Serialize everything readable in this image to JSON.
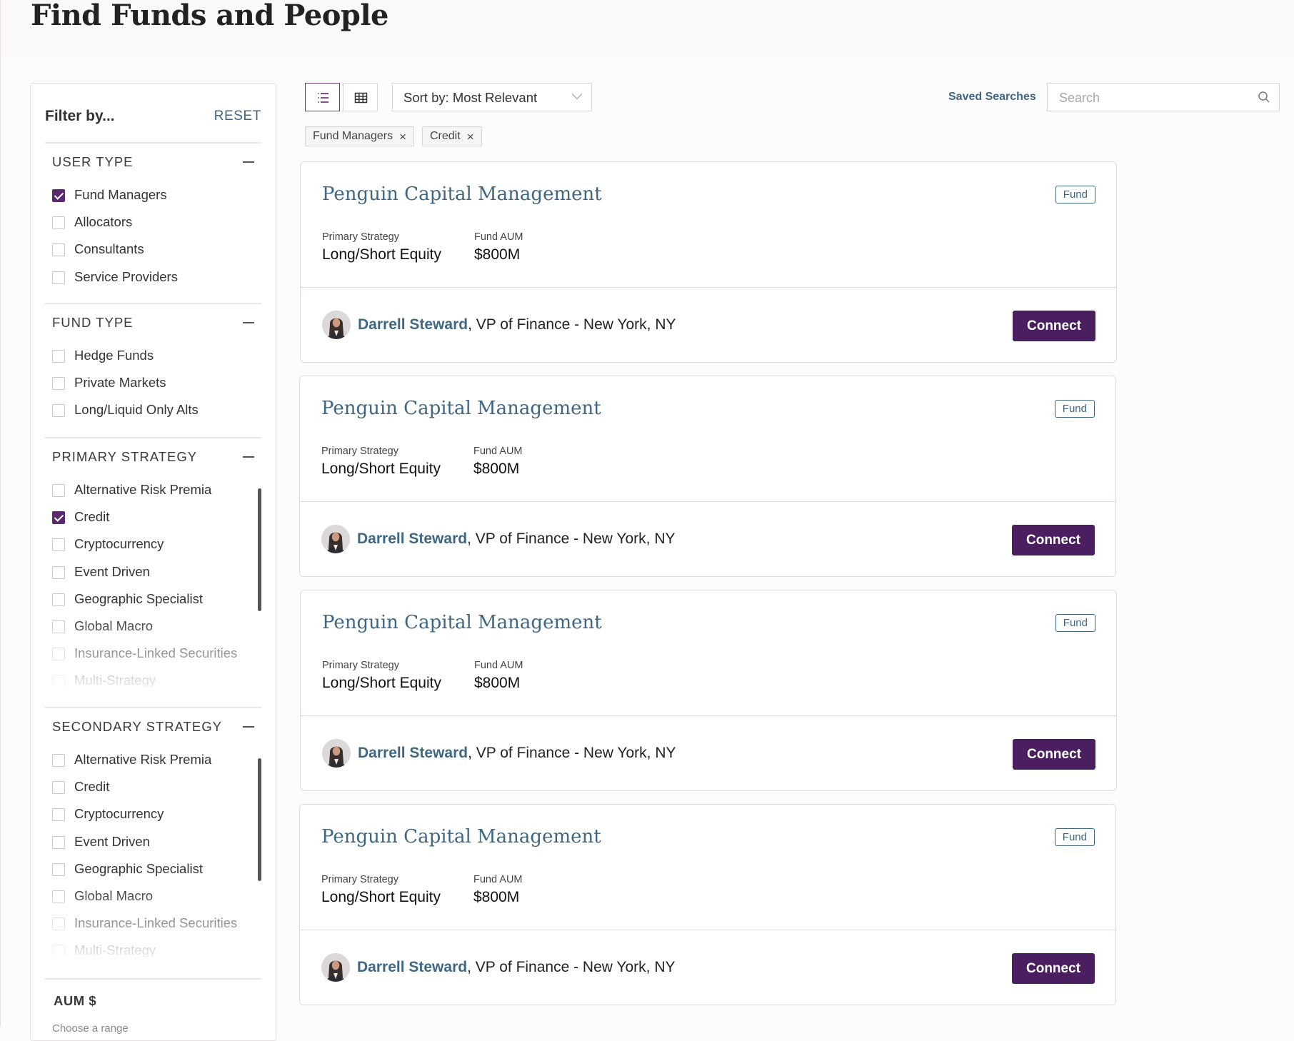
{
  "page": {
    "title": "Find Funds and People"
  },
  "sidebar": {
    "title": "Filter by...",
    "reset": "RESET",
    "sections": [
      {
        "title": "USER TYPE",
        "options": [
          {
            "label": "Fund Managers",
            "checked": true
          },
          {
            "label": "Allocators",
            "checked": false
          },
          {
            "label": "Consultants",
            "checked": false
          },
          {
            "label": "Service Providers",
            "checked": false
          }
        ]
      },
      {
        "title": "FUND TYPE",
        "options": [
          {
            "label": "Hedge Funds",
            "checked": false
          },
          {
            "label": "Private Markets",
            "checked": false
          },
          {
            "label": "Long/Liquid Only Alts",
            "checked": false
          }
        ]
      },
      {
        "title": "PRIMARY STRATEGY",
        "options": [
          {
            "label": "Alternative Risk Premia",
            "checked": false
          },
          {
            "label": "Credit",
            "checked": true
          },
          {
            "label": "Cryptocurrency",
            "checked": false
          },
          {
            "label": "Event Driven",
            "checked": false
          },
          {
            "label": "Geographic Specialist",
            "checked": false
          },
          {
            "label": "Global Macro",
            "checked": false
          },
          {
            "label": "Insurance-Linked Securities",
            "checked": false
          },
          {
            "label": "Multi-Strategy",
            "checked": false
          }
        ]
      },
      {
        "title": "SECONDARY STRATEGY",
        "options": [
          {
            "label": "Alternative Risk Premia",
            "checked": false
          },
          {
            "label": "Credit",
            "checked": false
          },
          {
            "label": "Cryptocurrency",
            "checked": false
          },
          {
            "label": "Event Driven",
            "checked": false
          },
          {
            "label": "Geographic Specialist",
            "checked": false
          },
          {
            "label": "Global Macro",
            "checked": false
          },
          {
            "label": "Insurance-Linked Securities",
            "checked": false
          },
          {
            "label": "Multi-Strategy",
            "checked": false
          }
        ]
      }
    ],
    "aum": {
      "title": "AUM $",
      "subtitle": "Choose a range"
    }
  },
  "toolbar": {
    "sort_label": "Sort by: Most Relevant",
    "saved_searches": "Saved Searches",
    "search_placeholder": "Search"
  },
  "chips": [
    {
      "label": "Fund Managers"
    },
    {
      "label": "Credit"
    }
  ],
  "results": [
    {
      "name": "Penguin Capital Management",
      "badge": "Fund",
      "strategy_label": "Primary Strategy",
      "strategy": "Long/Short Equity",
      "aum_label": "Fund AUM",
      "aum": "$800M",
      "contact_name": "Darrell Steward",
      "contact_detail": ", VP of Finance - New York, NY",
      "cta": "Connect"
    },
    {
      "name": "Penguin Capital Management",
      "badge": "Fund",
      "strategy_label": "Primary Strategy",
      "strategy": "Long/Short Equity",
      "aum_label": "Fund AUM",
      "aum": "$800M",
      "contact_name": "Darrell Steward",
      "contact_detail": ", VP of Finance - New York, NY",
      "cta": "Connect"
    },
    {
      "name": "Penguin Capital Management",
      "badge": "Fund",
      "strategy_label": "Primary Strategy",
      "strategy": "Long/Short Equity",
      "aum_label": "Fund AUM",
      "aum": "$800M",
      "contact_name": "Darrell Steward",
      "contact_detail": ", VP of Finance - New York, NY",
      "cta": "Connect"
    },
    {
      "name": "Penguin Capital Management",
      "badge": "Fund",
      "strategy_label": "Primary Strategy",
      "strategy": "Long/Short Equity",
      "aum_label": "Fund AUM",
      "aum": "$800M",
      "contact_name": "Darrell Steward",
      "contact_detail": ", VP of Finance - New York, NY",
      "cta": "Connect"
    }
  ],
  "colors": {
    "accent": "#4b1f5f",
    "link": "#3f6784",
    "checkbox": "#5b2a6e"
  },
  "icons": {
    "list_view": "list-icon",
    "grid_view": "grid-icon",
    "search": "search-icon",
    "remove": "close-icon",
    "sort": "chevron-down-icon"
  }
}
